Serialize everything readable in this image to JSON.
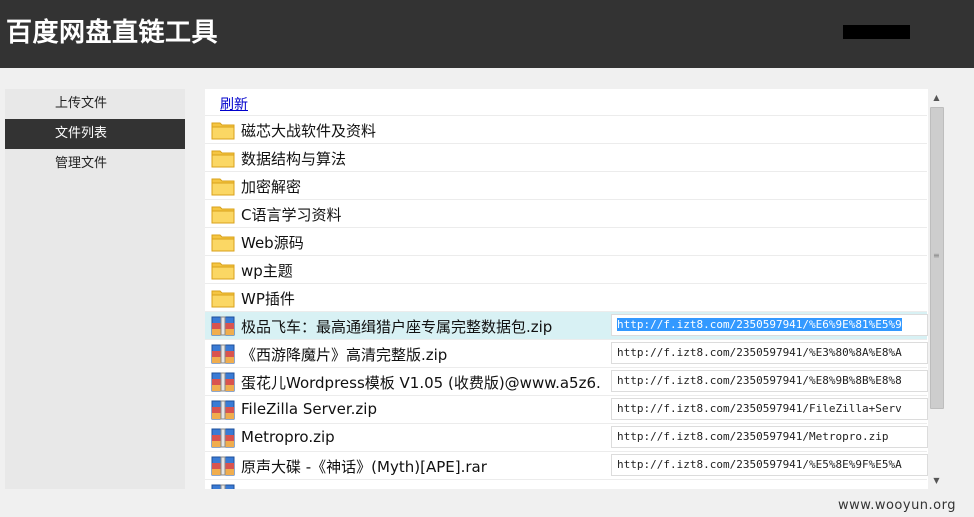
{
  "header": {
    "title": "百度网盘直链工具"
  },
  "sidebar": {
    "items": [
      {
        "label": "上传文件"
      },
      {
        "label": "文件列表"
      },
      {
        "label": "管理文件"
      }
    ]
  },
  "main": {
    "refresh_label": "刷新",
    "folders": [
      {
        "name": "磁芯大战软件及资料",
        "icon": "folder-icon"
      },
      {
        "name": "数据结构与算法",
        "icon": "folder-icon"
      },
      {
        "name": "加密解密",
        "icon": "folder-icon"
      },
      {
        "name": "C语言学习资料",
        "icon": "folder-icon"
      },
      {
        "name": "Web源码",
        "icon": "folder-icon"
      },
      {
        "name": "wp主题",
        "icon": "folder-icon"
      },
      {
        "name": "WP插件",
        "icon": "folder-icon"
      }
    ],
    "files": [
      {
        "name": "极品飞车：最高通缉猎户座专属完整数据包.zip",
        "link": "http://f.izt8.com/2350597941/%E6%9E%81%E5%9",
        "icon": "archive-icon"
      },
      {
        "name": "《西游降魔片》高清完整版.zip",
        "link": "http://f.izt8.com/2350597941/%E3%80%8A%E8%A",
        "icon": "archive-icon"
      },
      {
        "name": "蛋花儿Wordpress模板 V1.05 (收费版)@www.a5z6.",
        "link": "http://f.izt8.com/2350597941/%E8%9B%8B%E8%8",
        "icon": "archive-icon"
      },
      {
        "name": "FileZilla Server.zip",
        "link": "http://f.izt8.com/2350597941/FileZilla+Serv",
        "icon": "archive-icon"
      },
      {
        "name": "Metropro.zip",
        "link": "http://f.izt8.com/2350597941/Metropro.zip",
        "icon": "archive-icon"
      },
      {
        "name": "原声大碟 -《神话》(Myth)[APE].rar",
        "link": "http://f.izt8.com/2350597941/%E5%8E%9F%E5%A",
        "icon": "archive-icon"
      }
    ]
  },
  "watermark": "www.wooyun.org",
  "colors": {
    "header_bg": "#333333",
    "selected_row": "#d8f1f4",
    "link_highlight": "#3399ff",
    "refresh_link": "#0000cc"
  }
}
